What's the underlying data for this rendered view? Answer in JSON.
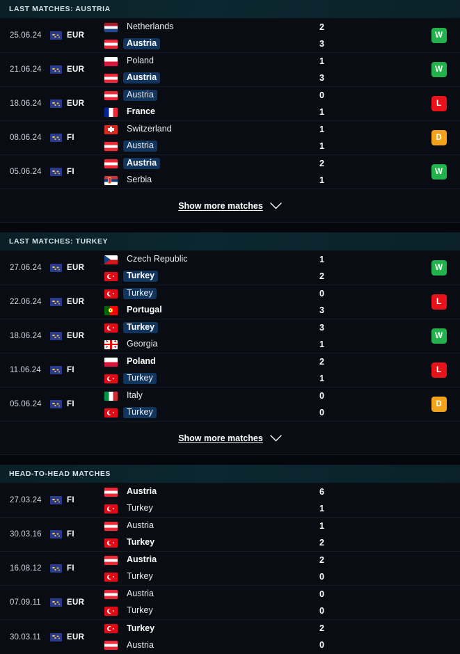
{
  "sections": [
    {
      "id": "last-matches-austria",
      "title": "LAST MATCHES: AUSTRIA",
      "show_more_label": "Show more matches",
      "has_show_more": true,
      "matches": [
        {
          "date": "25.06.24",
          "competition": "EUR",
          "home": {
            "name": "Netherlands",
            "flag": "netherlands",
            "bold": false,
            "highlight": false
          },
          "away": {
            "name": "Austria",
            "flag": "austria",
            "bold": true,
            "highlight": true
          },
          "home_score": "2",
          "away_score": "3",
          "result": "W"
        },
        {
          "date": "21.06.24",
          "competition": "EUR",
          "home": {
            "name": "Poland",
            "flag": "poland",
            "bold": false,
            "highlight": false
          },
          "away": {
            "name": "Austria",
            "flag": "austria",
            "bold": true,
            "highlight": true
          },
          "home_score": "1",
          "away_score": "3",
          "result": "W"
        },
        {
          "date": "18.06.24",
          "competition": "EUR",
          "home": {
            "name": "Austria",
            "flag": "austria",
            "bold": false,
            "highlight": true
          },
          "away": {
            "name": "France",
            "flag": "france",
            "bold": true,
            "highlight": false
          },
          "home_score": "0",
          "away_score": "1",
          "result": "L"
        },
        {
          "date": "08.06.24",
          "competition": "FI",
          "home": {
            "name": "Switzerland",
            "flag": "switzerland",
            "bold": false,
            "highlight": false
          },
          "away": {
            "name": "Austria",
            "flag": "austria",
            "bold": false,
            "highlight": true
          },
          "home_score": "1",
          "away_score": "1",
          "result": "D"
        },
        {
          "date": "05.06.24",
          "competition": "FI",
          "home": {
            "name": "Austria",
            "flag": "austria",
            "bold": true,
            "highlight": true
          },
          "away": {
            "name": "Serbia",
            "flag": "serbia",
            "bold": false,
            "highlight": false
          },
          "home_score": "2",
          "away_score": "1",
          "result": "W"
        }
      ]
    },
    {
      "id": "last-matches-turkey",
      "title": "LAST MATCHES: TURKEY",
      "show_more_label": "Show more matches",
      "has_show_more": true,
      "matches": [
        {
          "date": "27.06.24",
          "competition": "EUR",
          "home": {
            "name": "Czech Republic",
            "flag": "czech",
            "bold": false,
            "highlight": false
          },
          "away": {
            "name": "Turkey",
            "flag": "turkey",
            "bold": true,
            "highlight": true
          },
          "home_score": "1",
          "away_score": "2",
          "result": "W"
        },
        {
          "date": "22.06.24",
          "competition": "EUR",
          "home": {
            "name": "Turkey",
            "flag": "turkey",
            "bold": false,
            "highlight": true
          },
          "away": {
            "name": "Portugal",
            "flag": "portugal",
            "bold": true,
            "highlight": false
          },
          "home_score": "0",
          "away_score": "3",
          "result": "L"
        },
        {
          "date": "18.06.24",
          "competition": "EUR",
          "home": {
            "name": "Turkey",
            "flag": "turkey",
            "bold": true,
            "highlight": true
          },
          "away": {
            "name": "Georgia",
            "flag": "georgia",
            "bold": false,
            "highlight": false
          },
          "home_score": "3",
          "away_score": "1",
          "result": "W"
        },
        {
          "date": "11.06.24",
          "competition": "FI",
          "home": {
            "name": "Poland",
            "flag": "poland",
            "bold": true,
            "highlight": false
          },
          "away": {
            "name": "Turkey",
            "flag": "turkey",
            "bold": false,
            "highlight": true
          },
          "home_score": "2",
          "away_score": "1",
          "result": "L"
        },
        {
          "date": "05.06.24",
          "competition": "FI",
          "home": {
            "name": "Italy",
            "flag": "italy",
            "bold": false,
            "highlight": false
          },
          "away": {
            "name": "Turkey",
            "flag": "turkey",
            "bold": false,
            "highlight": true
          },
          "home_score": "0",
          "away_score": "0",
          "result": "D"
        }
      ]
    },
    {
      "id": "head-to-head-matches",
      "title": "HEAD-TO-HEAD MATCHES",
      "show_more_label": "Show more matches",
      "has_show_more": false,
      "matches": [
        {
          "date": "27.03.24",
          "competition": "FI",
          "home": {
            "name": "Austria",
            "flag": "austria",
            "bold": true,
            "highlight": false
          },
          "away": {
            "name": "Turkey",
            "flag": "turkey",
            "bold": false,
            "highlight": false
          },
          "home_score": "6",
          "away_score": "1",
          "result": ""
        },
        {
          "date": "30.03.16",
          "competition": "FI",
          "home": {
            "name": "Austria",
            "flag": "austria",
            "bold": false,
            "highlight": false
          },
          "away": {
            "name": "Turkey",
            "flag": "turkey",
            "bold": true,
            "highlight": false
          },
          "home_score": "1",
          "away_score": "2",
          "result": ""
        },
        {
          "date": "16.08.12",
          "competition": "FI",
          "home": {
            "name": "Austria",
            "flag": "austria",
            "bold": true,
            "highlight": false
          },
          "away": {
            "name": "Turkey",
            "flag": "turkey",
            "bold": false,
            "highlight": false
          },
          "home_score": "2",
          "away_score": "0",
          "result": ""
        },
        {
          "date": "07.09.11",
          "competition": "EUR",
          "home": {
            "name": "Austria",
            "flag": "austria",
            "bold": false,
            "highlight": false
          },
          "away": {
            "name": "Turkey",
            "flag": "turkey",
            "bold": false,
            "highlight": false
          },
          "home_score": "0",
          "away_score": "0",
          "result": ""
        },
        {
          "date": "30.03.11",
          "competition": "EUR",
          "home": {
            "name": "Turkey",
            "flag": "turkey",
            "bold": true,
            "highlight": false
          },
          "away": {
            "name": "Austria",
            "flag": "austria",
            "bold": false,
            "highlight": false
          },
          "home_score": "2",
          "away_score": "0",
          "result": ""
        }
      ]
    }
  ],
  "icons": {
    "competition": "globe-badge-icon",
    "chevron": "chevron-down-icon"
  },
  "colors": {
    "win": "#22b14c",
    "loss": "#e8121a",
    "draw": "#f2a31b",
    "highlight": "#12355e",
    "header_bg": "#0c2730",
    "row_bg": "#090c12"
  }
}
